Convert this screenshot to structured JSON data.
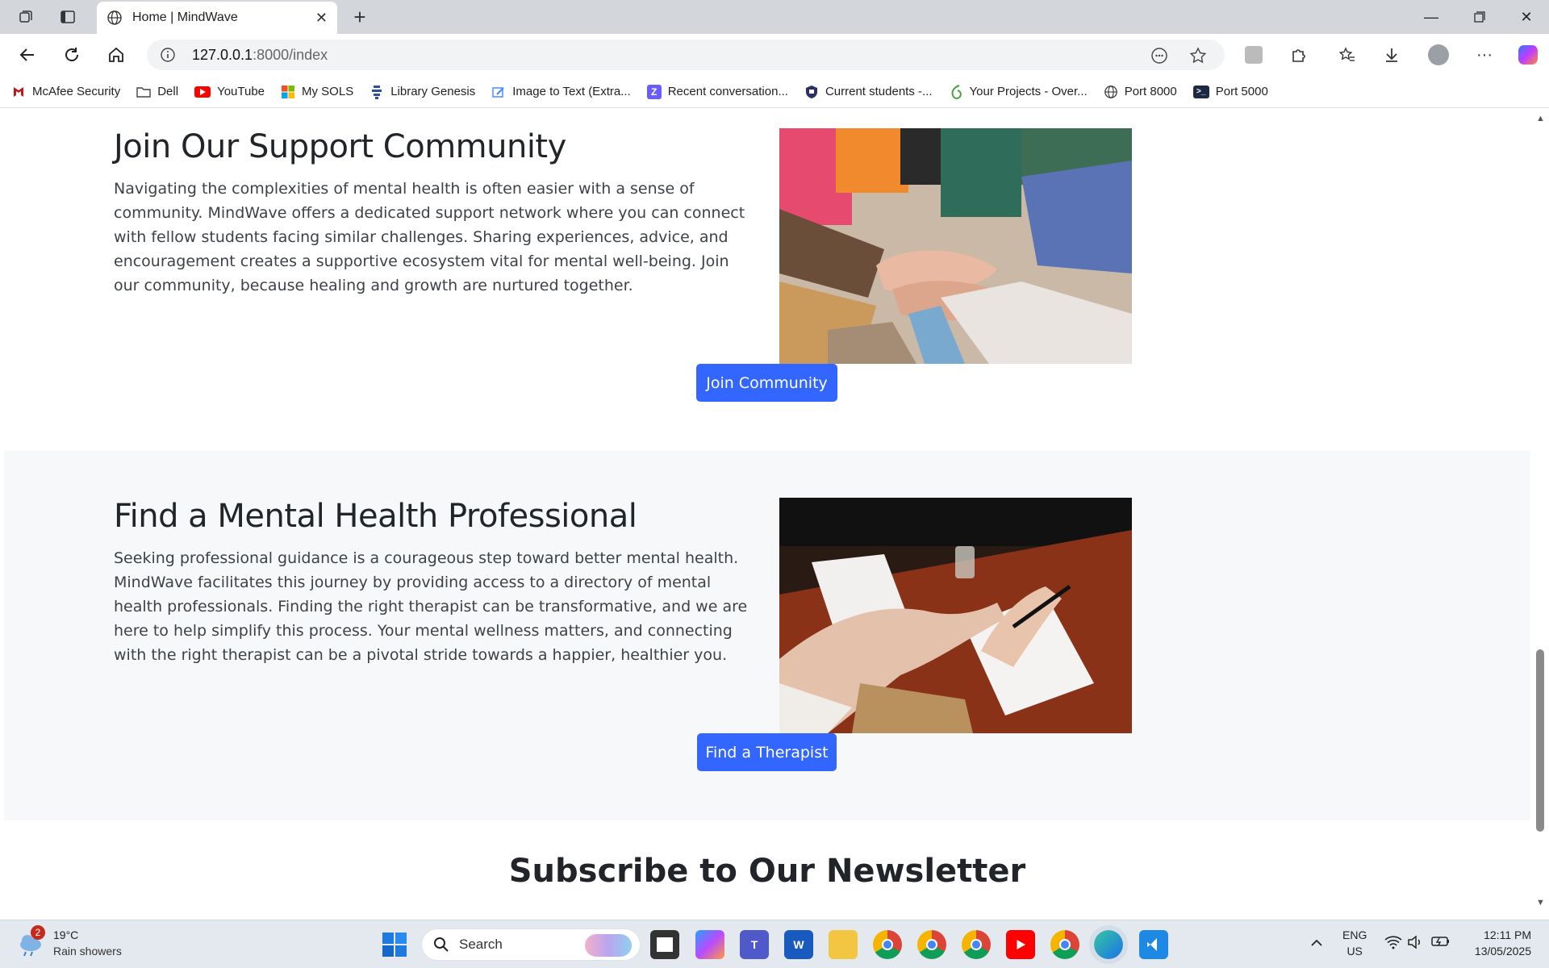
{
  "browser": {
    "tab_title": "Home | MindWave",
    "url_host": "127.0.0.1",
    "url_rest": ":8000/index",
    "bookmarks": [
      {
        "label": "McAfee Security",
        "icon": "mcafee-icon",
        "color": "#c01818"
      },
      {
        "label": "Dell",
        "icon": "folder-icon",
        "color": "#555555"
      },
      {
        "label": "YouTube",
        "icon": "youtube-icon",
        "color": "#ff0000"
      },
      {
        "label": "My SOLS",
        "icon": "microsoft-icon",
        "color": "#f25022"
      },
      {
        "label": "Library Genesis",
        "icon": "libgen-icon",
        "color": "#2a4f9c"
      },
      {
        "label": "Image to Text (Extra...",
        "icon": "image-text-icon",
        "color": "#3a86ff"
      },
      {
        "label": "Recent conversation...",
        "icon": "z-icon",
        "color": "#6a5cff"
      },
      {
        "label": "Current students -...",
        "icon": "shield-icon",
        "color": "#2b2f6a"
      },
      {
        "label": "Your Projects - Over...",
        "icon": "overleaf-icon",
        "color": "#47a141"
      },
      {
        "label": "Port 8000",
        "icon": "globe-icon",
        "color": "#444444"
      },
      {
        "label": "Port 5000",
        "icon": "terminal-icon",
        "color": "#1e2a44"
      }
    ]
  },
  "page": {
    "community": {
      "heading": "Join Our Support Community",
      "body": "Navigating the complexities of mental health is often easier with a sense of community. MindWave offers a dedicated support network where you can connect with fellow students facing similar challenges. Sharing experiences, advice, and encouragement creates a supportive ecosystem vital for mental well-being. Join our community, because healing and growth are nurtured together.",
      "button": "Join Community"
    },
    "professional": {
      "heading": "Find a Mental Health Professional",
      "body": "Seeking professional guidance is a courageous step toward better mental health. MindWave facilitates this journey by providing access to a directory of mental health professionals. Finding the right therapist can be transformative, and we are here to help simplify this process. Your mental wellness matters, and connecting with the right therapist can be a pivotal stride towards a happier, healthier you.",
      "button": "Find a Therapist"
    },
    "newsletter": {
      "heading": "Subscribe to Our Newsletter"
    },
    "accent_color": "#3366ff"
  },
  "taskbar": {
    "weather_badge": "2",
    "temperature": "19°C",
    "condition": "Rain showers",
    "search_placeholder": "Search",
    "lang_line1": "ENG",
    "lang_line2": "US",
    "time": "12:11 PM",
    "date": "13/05/2025"
  }
}
